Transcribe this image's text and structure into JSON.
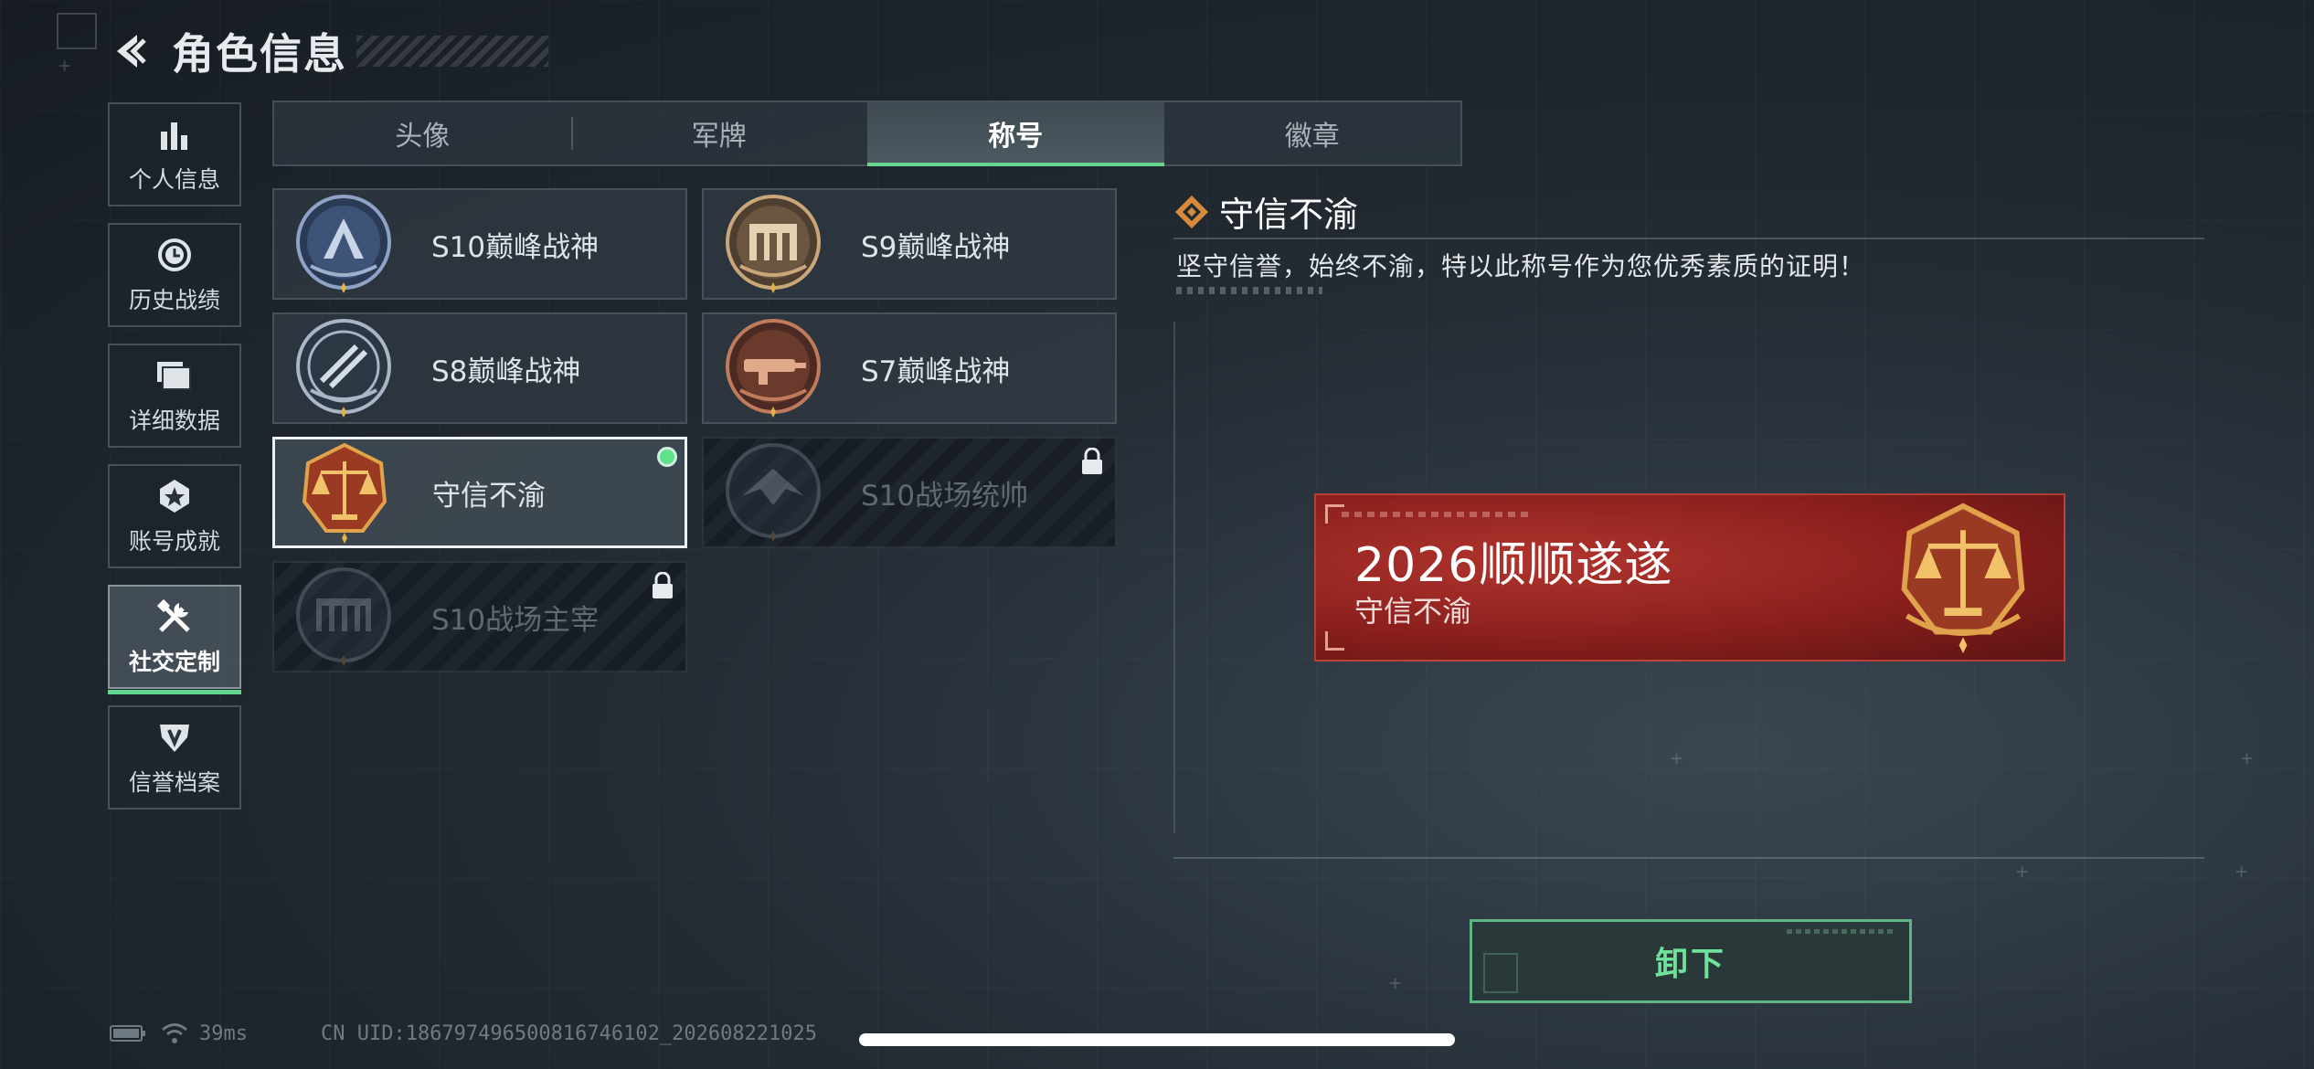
{
  "header": {
    "title": "角色信息"
  },
  "sidebar": {
    "items": [
      {
        "label": "个人信息",
        "icon": "bar-chart-icon"
      },
      {
        "label": "历史战绩",
        "icon": "clock-history-icon"
      },
      {
        "label": "详细数据",
        "icon": "folder-icon"
      },
      {
        "label": "账号成就",
        "icon": "achievement-icon"
      },
      {
        "label": "社交定制",
        "icon": "tools-icon",
        "active": true
      },
      {
        "label": "信誉档案",
        "icon": "reputation-icon"
      }
    ]
  },
  "tabs": [
    {
      "label": "头像"
    },
    {
      "label": "军牌"
    },
    {
      "label": "称号",
      "active": true
    },
    {
      "label": "徽章"
    }
  ],
  "titles": [
    {
      "name": "S10巅峰战神",
      "state": "owned"
    },
    {
      "name": "S9巅峰战神",
      "state": "owned"
    },
    {
      "name": "S8巅峰战神",
      "state": "owned"
    },
    {
      "name": "S7巅峰战神",
      "state": "owned"
    },
    {
      "name": "守信不渝",
      "state": "equipped"
    },
    {
      "name": "S10战场统帅",
      "state": "locked"
    },
    {
      "name": "S10战场主宰",
      "state": "locked"
    }
  ],
  "detail": {
    "title": "守信不渝",
    "description": "坚守信誉，始终不渝，特以此称号作为您优秀素质的证明！",
    "preview": {
      "main_text": "2026顺顺遂遂",
      "sub_text": "守信不渝"
    },
    "action_label": "卸下"
  },
  "status_bar": {
    "ping": "39ms",
    "uid": "CN UID:18679749650081674610​2_202608221025"
  },
  "colors": {
    "accent_green": "#63d690",
    "nameplate_red": "#8a1f1d",
    "gold": "#d9a441"
  }
}
